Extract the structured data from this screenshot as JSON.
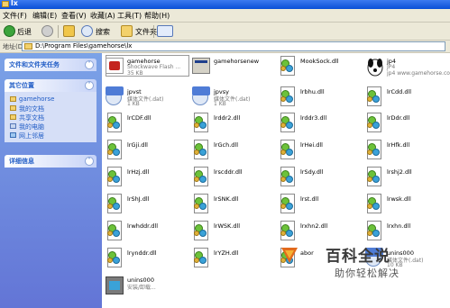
{
  "window": {
    "title": "lx"
  },
  "menu": {
    "file": "文件(F)",
    "edit": "编辑(E)",
    "view": "查看(V)",
    "favorites": "收藏(A)",
    "tools": "工具(T)",
    "help": "帮助(H)"
  },
  "toolbar": {
    "back_label": "后退",
    "search_label": "搜索",
    "folders_label": "文件夹"
  },
  "address": {
    "label": "地址(D)",
    "path": "D:\\Program Files\\gamehorse\\lx"
  },
  "taskpane": {
    "file_tasks_title": "文件和文件夹任务",
    "other_places_title": "其它位置",
    "other_places": [
      "gamehorse",
      "我的文档",
      "共享文档",
      "我的电脑",
      "网上邻居"
    ],
    "details_title": "详细信息"
  },
  "files": [
    {
      "name": "gamehorse",
      "sub1": "Shockwave Flash ...",
      "sub2": "35 KB",
      "icon": "flash-icon"
    },
    {
      "name": "gamehorsenew",
      "sub1": "",
      "sub2": "",
      "icon": "app-icon"
    },
    {
      "name": "MookSock.dll",
      "sub1": "",
      "sub2": "",
      "icon": "dll-icon"
    },
    {
      "name": "jp4",
      "sub1": "JP4",
      "sub2": "jp4 www.gamehorse.com",
      "icon": "dog-icon"
    },
    {
      "name": "jpvst",
      "sub1": "媒体文件(.dat)",
      "sub2": "1 KB",
      "icon": "video-icon"
    },
    {
      "name": "jpvsy",
      "sub1": "媒体文件(.dat)",
      "sub2": "1 KB",
      "icon": "video-icon"
    },
    {
      "name": "lrbhu.dll",
      "sub1": "",
      "sub2": "",
      "icon": "dll-icon"
    },
    {
      "name": "lrCdd.dll",
      "sub1": "",
      "sub2": "",
      "icon": "dll-icon"
    },
    {
      "name": "lrCDF.dll",
      "sub1": "",
      "sub2": "",
      "icon": "dll-icon"
    },
    {
      "name": "lrddr2.dll",
      "sub1": "",
      "sub2": "",
      "icon": "dll-icon"
    },
    {
      "name": "lrddr3.dll",
      "sub1": "",
      "sub2": "",
      "icon": "dll-icon"
    },
    {
      "name": "lrDdr.dll",
      "sub1": "",
      "sub2": "",
      "icon": "dll-icon"
    },
    {
      "name": "lrGji.dll",
      "sub1": "",
      "sub2": "",
      "icon": "dll-icon"
    },
    {
      "name": "lrGch.dll",
      "sub1": "",
      "sub2": "",
      "icon": "dll-icon"
    },
    {
      "name": "lrHei.dll",
      "sub1": "",
      "sub2": "",
      "icon": "dll-icon"
    },
    {
      "name": "lrHfk.dll",
      "sub1": "",
      "sub2": "",
      "icon": "dll-icon"
    },
    {
      "name": "lrHzj.dll",
      "sub1": "",
      "sub2": "",
      "icon": "dll-icon"
    },
    {
      "name": "lrscddr.dll",
      "sub1": "",
      "sub2": "",
      "icon": "dll-icon"
    },
    {
      "name": "lrSdy.dll",
      "sub1": "",
      "sub2": "",
      "icon": "dll-icon"
    },
    {
      "name": "lrshj2.dll",
      "sub1": "",
      "sub2": "",
      "icon": "dll-icon"
    },
    {
      "name": "lrShJ.dll",
      "sub1": "",
      "sub2": "",
      "icon": "dll-icon"
    },
    {
      "name": "lrSNK.dll",
      "sub1": "",
      "sub2": "",
      "icon": "dll-icon"
    },
    {
      "name": "lrst.dll",
      "sub1": "",
      "sub2": "",
      "icon": "dll-icon"
    },
    {
      "name": "lrwsk.dll",
      "sub1": "",
      "sub2": "",
      "icon": "dll-icon"
    },
    {
      "name": "lrwhddr.dll",
      "sub1": "",
      "sub2": "",
      "icon": "dll-icon"
    },
    {
      "name": "lrWSK.dll",
      "sub1": "",
      "sub2": "",
      "icon": "dll-icon"
    },
    {
      "name": "lrxhn2.dll",
      "sub1": "",
      "sub2": "",
      "icon": "dll-icon"
    },
    {
      "name": "lrxhn.dll",
      "sub1": "",
      "sub2": "",
      "icon": "dll-icon"
    },
    {
      "name": "lrynddr.dll",
      "sub1": "",
      "sub2": "",
      "icon": "dll-icon"
    },
    {
      "name": "lrYZH.dll",
      "sub1": "",
      "sub2": "",
      "icon": "dll-icon"
    },
    {
      "name": "abor",
      "sub1": "",
      "sub2": "",
      "icon": "dll-icon"
    },
    {
      "name": "unins000",
      "sub1": "媒体文件(.dat)",
      "sub2": "10 KB",
      "icon": "video-icon"
    },
    {
      "name": "unins000",
      "sub1": "安装/卸载...",
      "sub2": "",
      "icon": "installer-icon"
    }
  ],
  "watermark": {
    "title": "百科全说",
    "subtitle": "助你轻松解决"
  },
  "colors": {
    "titlebar": "#0a4fd6",
    "taskpane": "#6375d6",
    "panel_title": "#215dc6",
    "chrome": "#ece9d8"
  }
}
